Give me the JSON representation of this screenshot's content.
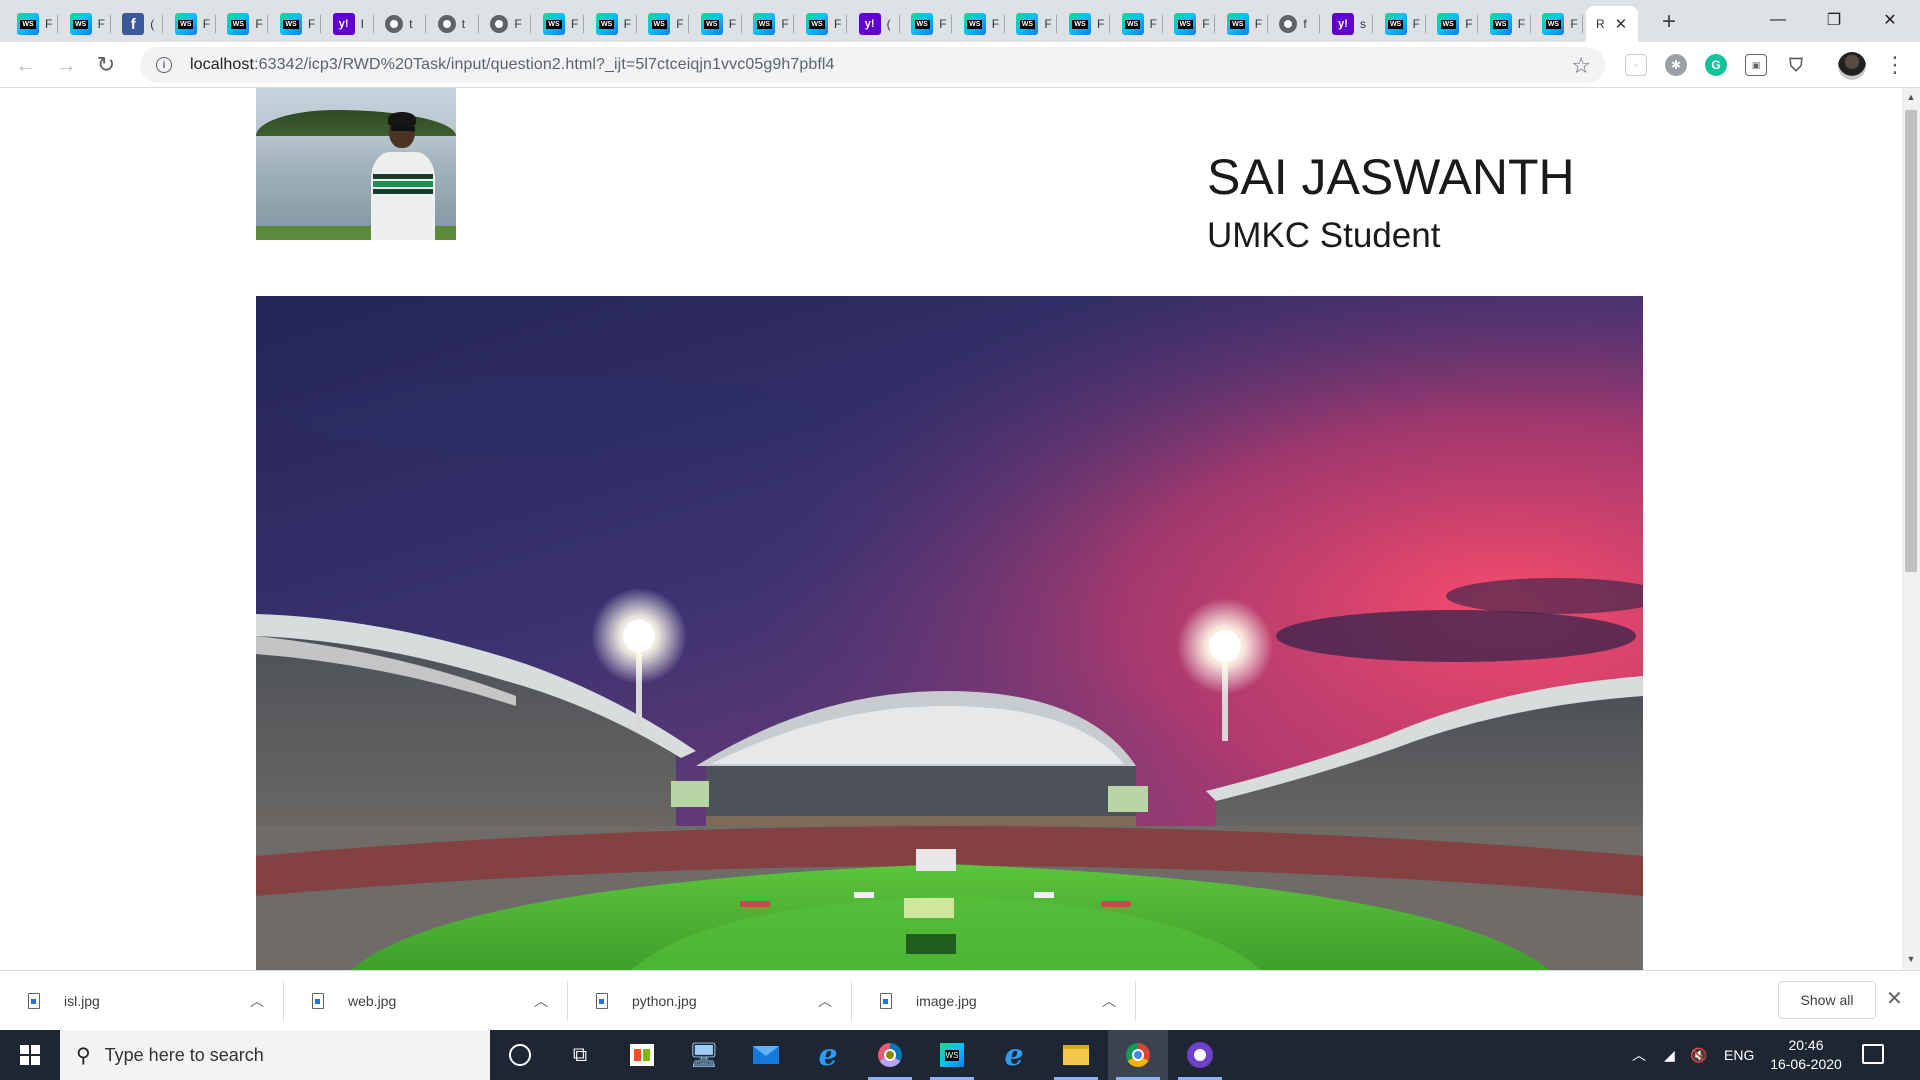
{
  "browser": {
    "tabs": [
      {
        "icon": "webstorm-icon",
        "title": "F"
      },
      {
        "icon": "webstorm-icon",
        "title": "F"
      },
      {
        "icon": "facebook-icon",
        "title": "("
      },
      {
        "icon": "webstorm-icon",
        "title": "F"
      },
      {
        "icon": "webstorm-icon",
        "title": "F"
      },
      {
        "icon": "webstorm-icon",
        "title": "F"
      },
      {
        "icon": "yahoo-icon",
        "title": "I"
      },
      {
        "icon": "globe-icon",
        "title": "t"
      },
      {
        "icon": "globe-icon",
        "title": "t"
      },
      {
        "icon": "globe-icon",
        "title": "F"
      },
      {
        "icon": "webstorm-icon",
        "title": "F"
      },
      {
        "icon": "webstorm-icon",
        "title": "F"
      },
      {
        "icon": "webstorm-icon",
        "title": "F"
      },
      {
        "icon": "webstorm-icon",
        "title": "F"
      },
      {
        "icon": "webstorm-icon",
        "title": "F"
      },
      {
        "icon": "webstorm-icon",
        "title": "F"
      },
      {
        "icon": "yahoo-icon",
        "title": "("
      },
      {
        "icon": "webstorm-icon",
        "title": "F"
      },
      {
        "icon": "webstorm-icon",
        "title": "F"
      },
      {
        "icon": "webstorm-icon",
        "title": "F"
      },
      {
        "icon": "webstorm-icon",
        "title": "F"
      },
      {
        "icon": "webstorm-icon",
        "title": "F"
      },
      {
        "icon": "webstorm-icon",
        "title": "F"
      },
      {
        "icon": "webstorm-icon",
        "title": "F"
      },
      {
        "icon": "globe-icon",
        "title": "f"
      },
      {
        "icon": "yahoo-icon",
        "title": "s"
      },
      {
        "icon": "webstorm-icon",
        "title": "F"
      },
      {
        "icon": "webstorm-icon",
        "title": "F"
      },
      {
        "icon": "webstorm-icon",
        "title": "F"
      },
      {
        "icon": "webstorm-icon",
        "title": "F"
      }
    ],
    "active_tab": {
      "title": "R",
      "close": "✕"
    },
    "new_tab": "+",
    "window_controls": {
      "minimize": "—",
      "restore": "❐",
      "close": "✕"
    },
    "url_host": "localhost",
    "url_rest": ":63342/icp3/RWD%20Task/input/question2.html?_ijt=5l7ctceiqjn1vvc05g9h7pbfl4"
  },
  "page": {
    "name": "SAI JASWANTH",
    "subtitle": "UMKC Student"
  },
  "downloads": {
    "items": [
      {
        "file": "isl.jpg"
      },
      {
        "file": "web.jpg"
      },
      {
        "file": "python.jpg"
      },
      {
        "file": "image.jpg"
      }
    ],
    "show_all": "Show all",
    "close": "✕"
  },
  "taskbar": {
    "search_placeholder": "Type here to search",
    "lang": "ENG",
    "time": "20:46",
    "date": "16-06-2020"
  },
  "colors": {
    "tabstrip": "#dee1e6",
    "taskbar": "#1f2633",
    "field": "#3bb84a",
    "sky_top": "#2b2a5e",
    "sky_sunset": "#e2406b"
  }
}
